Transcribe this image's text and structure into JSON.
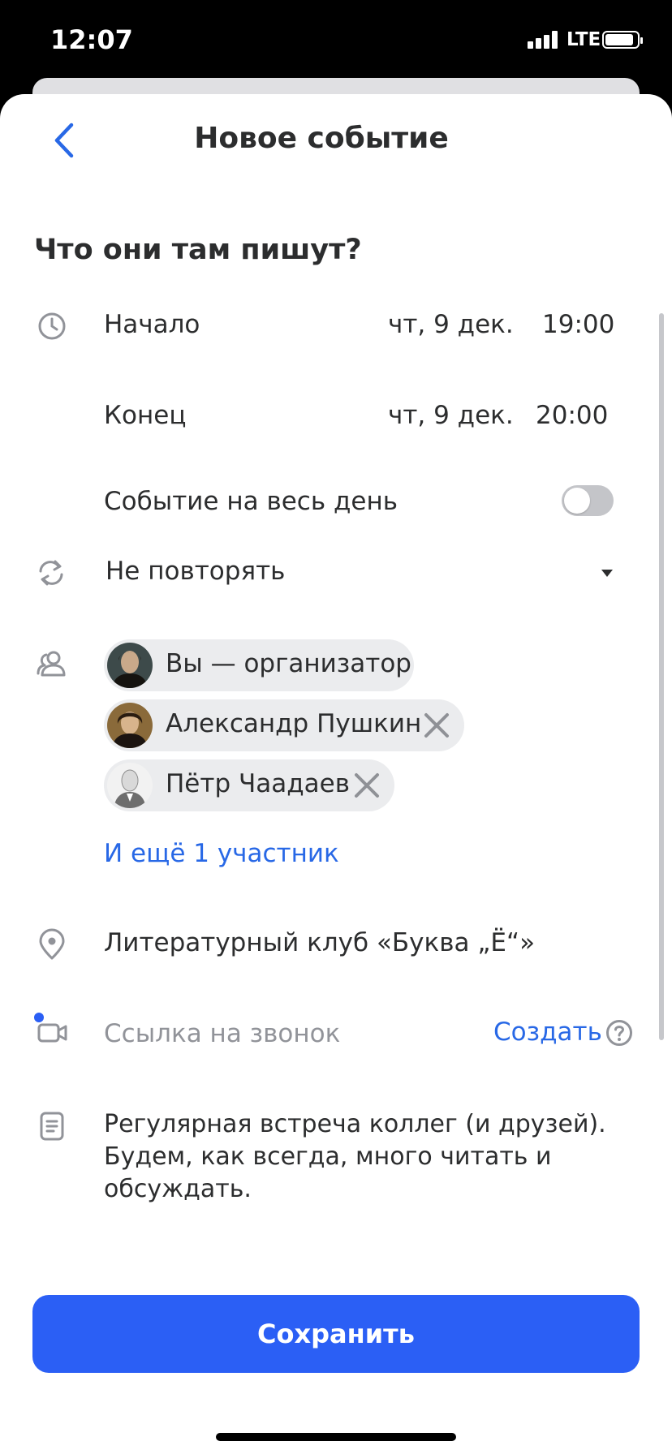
{
  "status_bar": {
    "time": "12:07",
    "network": "LTE"
  },
  "header": {
    "title": "Новое событие"
  },
  "event": {
    "title": "Что они там пишут?"
  },
  "start": {
    "label": "Начало",
    "date": "чт, 9 дек.",
    "time": "19:00"
  },
  "end": {
    "label": "Конец",
    "date": "чт, 9 дек.",
    "time": "20:00"
  },
  "all_day": {
    "label": "Событие на весь день",
    "enabled": false
  },
  "repeat": {
    "label": "Не повторять"
  },
  "participants": {
    "items": [
      {
        "name": "Вы — организатор",
        "removable": false
      },
      {
        "name": "Александр Пушкин",
        "removable": true
      },
      {
        "name": "Пётр Чаадаев",
        "removable": true
      }
    ],
    "more_link": "И ещё 1 участник"
  },
  "location": {
    "value": "Литературный клуб «Буква „Ё“»"
  },
  "call": {
    "placeholder": "Ссылка на звонок",
    "create_label": "Создать"
  },
  "description": {
    "lines": [
      "Регулярная встреча коллег (и друзей).",
      "Будем, как всегда, много читать и",
      "обсуждать."
    ]
  },
  "footer": {
    "save_label": "Сохранить"
  },
  "colors": {
    "accent": "#2b5ff5",
    "link": "#2868e6",
    "text": "#2c2d2e",
    "muted": "#919399",
    "chip": "#ebecee"
  }
}
